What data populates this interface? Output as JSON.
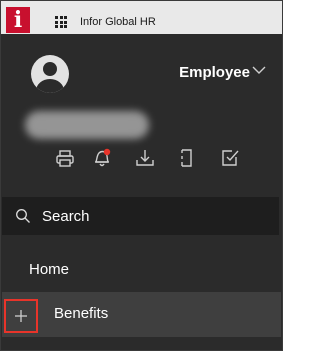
{
  "header": {
    "logo_text": "i",
    "app_title": "Infor Global HR",
    "brand_color": "#c8102e"
  },
  "user": {
    "role": "Employee"
  },
  "actions": [
    {
      "icon": "printer-icon"
    },
    {
      "icon": "bell-icon",
      "badge_color": "#e8342a"
    },
    {
      "icon": "download-icon"
    },
    {
      "icon": "document-icon"
    },
    {
      "icon": "checkbox-icon"
    }
  ],
  "search": {
    "label": "Search"
  },
  "nav": {
    "home_label": "Home",
    "benefits_label": "Benefits"
  }
}
